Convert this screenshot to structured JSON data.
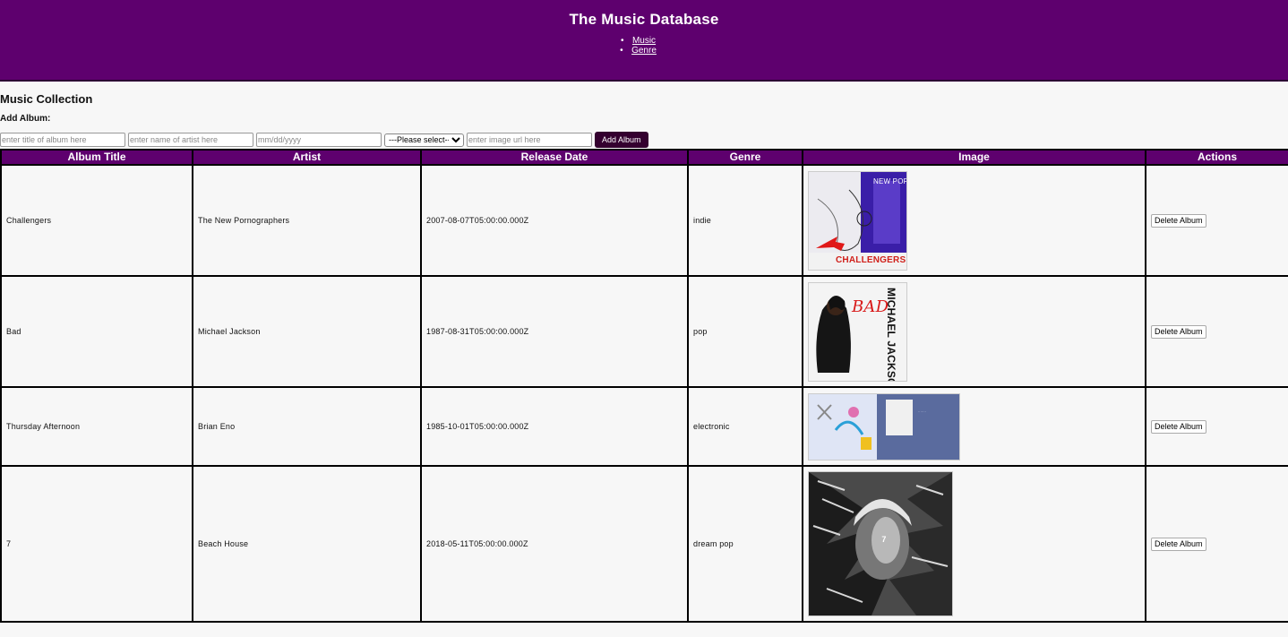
{
  "header": {
    "title": "The Music Database",
    "nav": [
      "Music",
      "Genre"
    ]
  },
  "section_title": "Music Collection",
  "add_album": {
    "label": "Add Album:",
    "title_placeholder": "enter title of album here",
    "artist_placeholder": "enter name of artist here",
    "date_placeholder": "mm/dd/yyyy",
    "genre_selected": "---Please select---",
    "image_placeholder": "enter image url here",
    "button": "Add Album"
  },
  "table": {
    "columns": [
      "Album Title",
      "Artist",
      "Release Date",
      "Genre",
      "Image",
      "Actions"
    ],
    "rows": [
      {
        "title": "Challengers",
        "artist": "The New Pornographers",
        "release": "2007-08-07T05:00:00.000Z",
        "genre": "indie",
        "cover_text": "NEW PORNOGRAPHERS",
        "cover_sub": "CHALLENGERS",
        "action": "Delete Album"
      },
      {
        "title": "Bad",
        "artist": "Michael Jackson",
        "release": "1987-08-31T05:00:00.000Z",
        "genre": "pop",
        "cover_text": "BAD",
        "cover_sub": "MICHAEL JACKSON",
        "action": "Delete Album"
      },
      {
        "title": "Thursday Afternoon",
        "artist": "Brian Eno",
        "release": "1985-10-01T05:00:00.000Z",
        "genre": "electronic",
        "cover_text": "",
        "cover_sub": "",
        "action": "Delete Album"
      },
      {
        "title": "7",
        "artist": "Beach House",
        "release": "2018-05-11T05:00:00.000Z",
        "genre": "dream pop",
        "cover_text": "7",
        "cover_sub": "",
        "action": "Delete Album"
      }
    ]
  },
  "colors": {
    "header_bg": "#5e006e",
    "button_bg": "#34002f"
  }
}
